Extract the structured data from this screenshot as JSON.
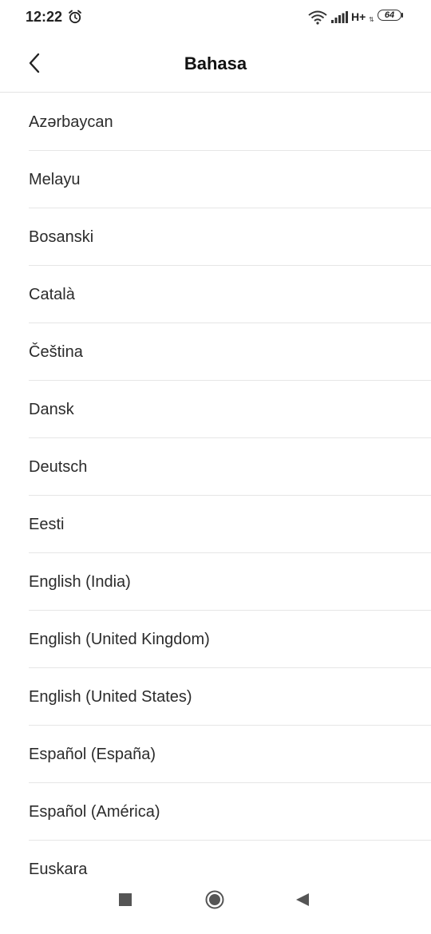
{
  "status_bar": {
    "time": "12:22",
    "network_type": "H+",
    "battery_level": "64",
    "icons": [
      "alarm-icon",
      "wifi-icon",
      "signal-icon",
      "battery-icon"
    ]
  },
  "header": {
    "title": "Bahasa",
    "back_icon": "chevron-left-icon"
  },
  "languages": [
    "Azərbaycan",
    "Melayu",
    "Bosanski",
    "Català",
    "Čeština",
    "Dansk",
    "Deutsch",
    "Eesti",
    "English (India)",
    "English (United Kingdom)",
    "English (United States)",
    "Español (España)",
    "Español (América)",
    "Euskara"
  ],
  "nav_bar": {
    "icons": [
      "recents-square-icon",
      "home-circle-icon",
      "back-triangle-icon"
    ]
  },
  "colors": {
    "background": "#ffffff",
    "text": "#2b2b2b",
    "divider": "#e6e6e6"
  }
}
